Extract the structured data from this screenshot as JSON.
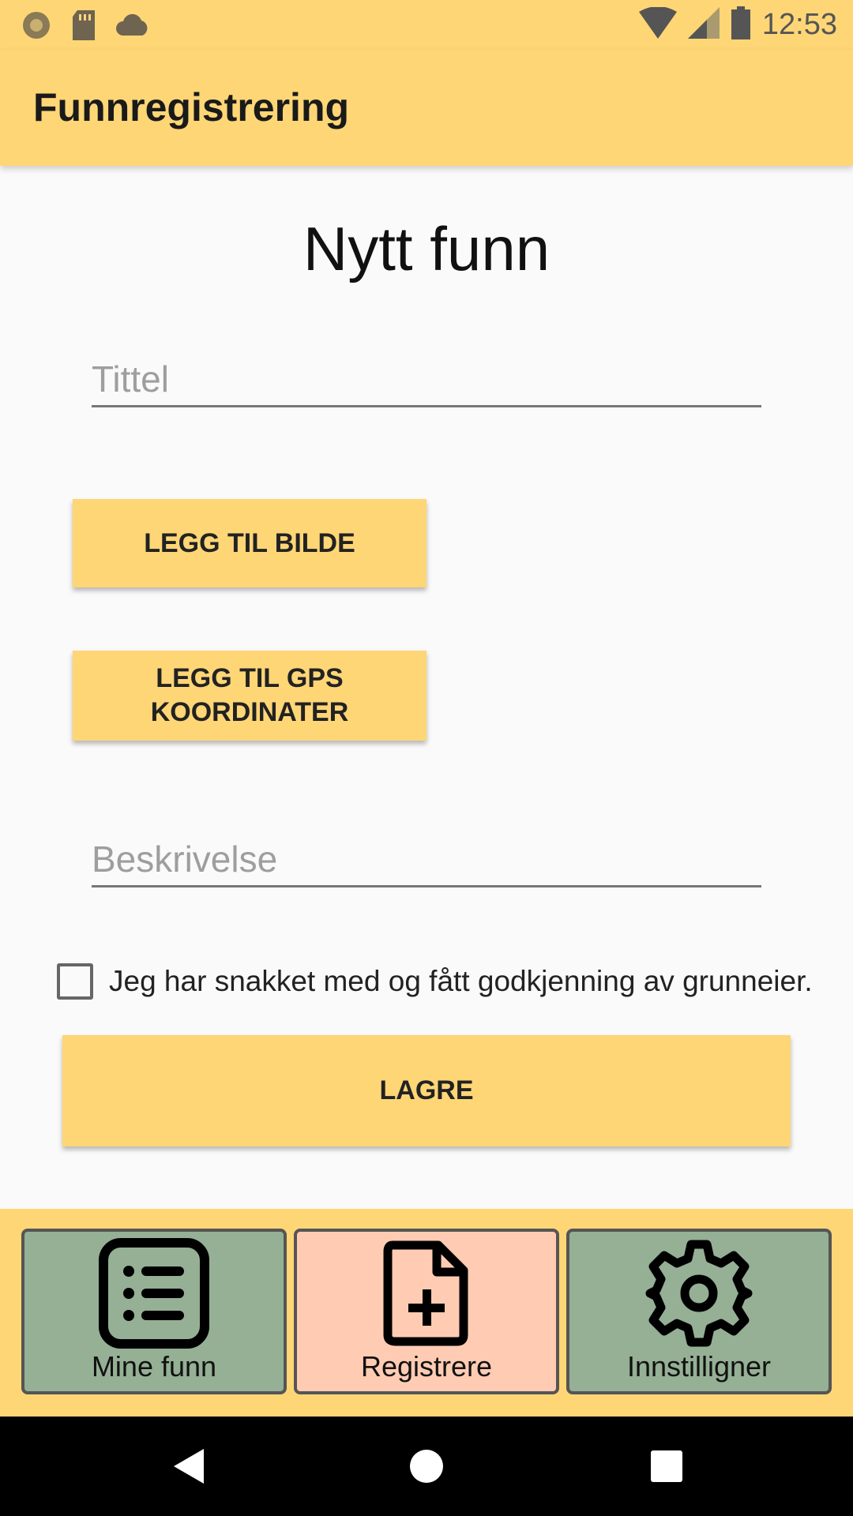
{
  "status_bar": {
    "time": "12:53",
    "left_icons": [
      "record-icon",
      "sd-card-icon",
      "cloud-icon"
    ],
    "right_icons": [
      "wifi-icon",
      "signal-icon",
      "battery-icon"
    ]
  },
  "app_bar": {
    "title": "Funnregistrering"
  },
  "form": {
    "heading": "Nytt funn",
    "title_placeholder": "Tittel",
    "add_image_label": "LEGG TIL BILDE",
    "add_gps_label": "LEGG TIL GPS KOORDINATER",
    "description_placeholder": "Beskrivelse",
    "consent_label": "Jeg har snakket med og fått godkjenning av grunneier.",
    "consent_checked": false,
    "save_label": "LAGRE"
  },
  "bottom_nav": {
    "items": [
      {
        "label": "Mine funn",
        "icon": "list-icon",
        "color": "#95b095",
        "active": false
      },
      {
        "label": "Registrere",
        "icon": "add-document-icon",
        "color": "#ffccb3",
        "active": true
      },
      {
        "label": "Innstilligner",
        "icon": "gear-icon",
        "color": "#95b095",
        "active": false
      }
    ]
  },
  "system_nav": {
    "icons": [
      "back-icon",
      "home-icon",
      "recents-icon"
    ]
  },
  "colors": {
    "accent": "#ffd676",
    "nav_inactive": "#95b095",
    "nav_active": "#ffccb3"
  }
}
